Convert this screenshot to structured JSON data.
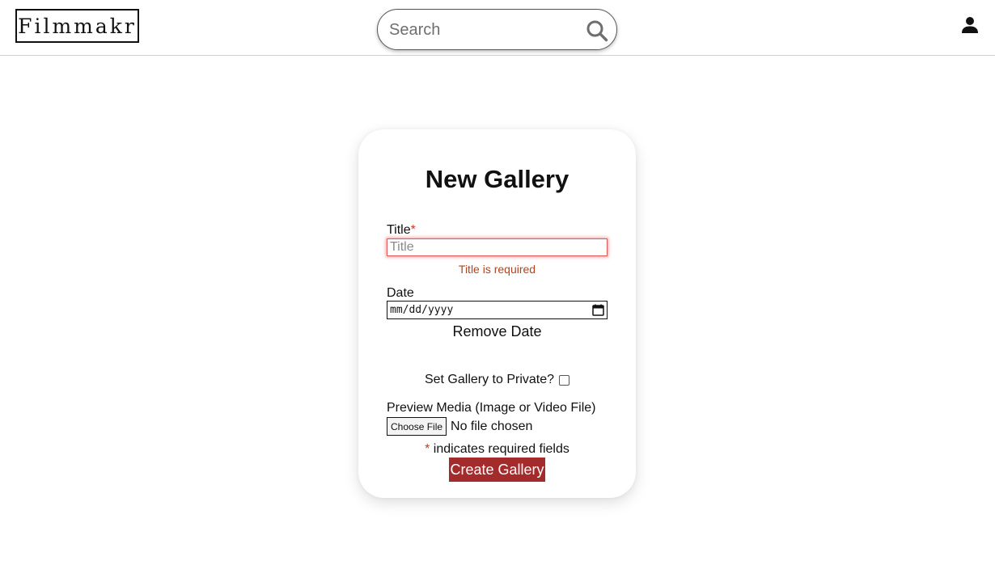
{
  "header": {
    "logo_text": "Filmmakr",
    "search": {
      "placeholder": "Search",
      "value": ""
    },
    "icons": {
      "search": "search-icon",
      "profile": "user-icon"
    }
  },
  "form": {
    "title": "New Gallery",
    "title_field": {
      "label": "Title",
      "required_marker": "*",
      "placeholder": "Title",
      "value": "",
      "error": "Title is required"
    },
    "date_field": {
      "label": "Date",
      "placeholder": "mm/dd/yyyy",
      "value": ""
    },
    "remove_date_label": "Remove Date",
    "private_label": "Set Gallery to Private?",
    "private_checked": false,
    "media_field": {
      "label": "Preview Media (Image or Video File)",
      "choose_file_label": "Choose File",
      "file_status": "No file chosen"
    },
    "required_note": {
      "marker": "*",
      "text": " indicates required fields"
    },
    "submit_label": "Create Gallery"
  },
  "colors": {
    "accent": "#a32b2b",
    "required": "#c0392b",
    "error_text": "#b5421c",
    "error_border": "#e05a5a"
  }
}
